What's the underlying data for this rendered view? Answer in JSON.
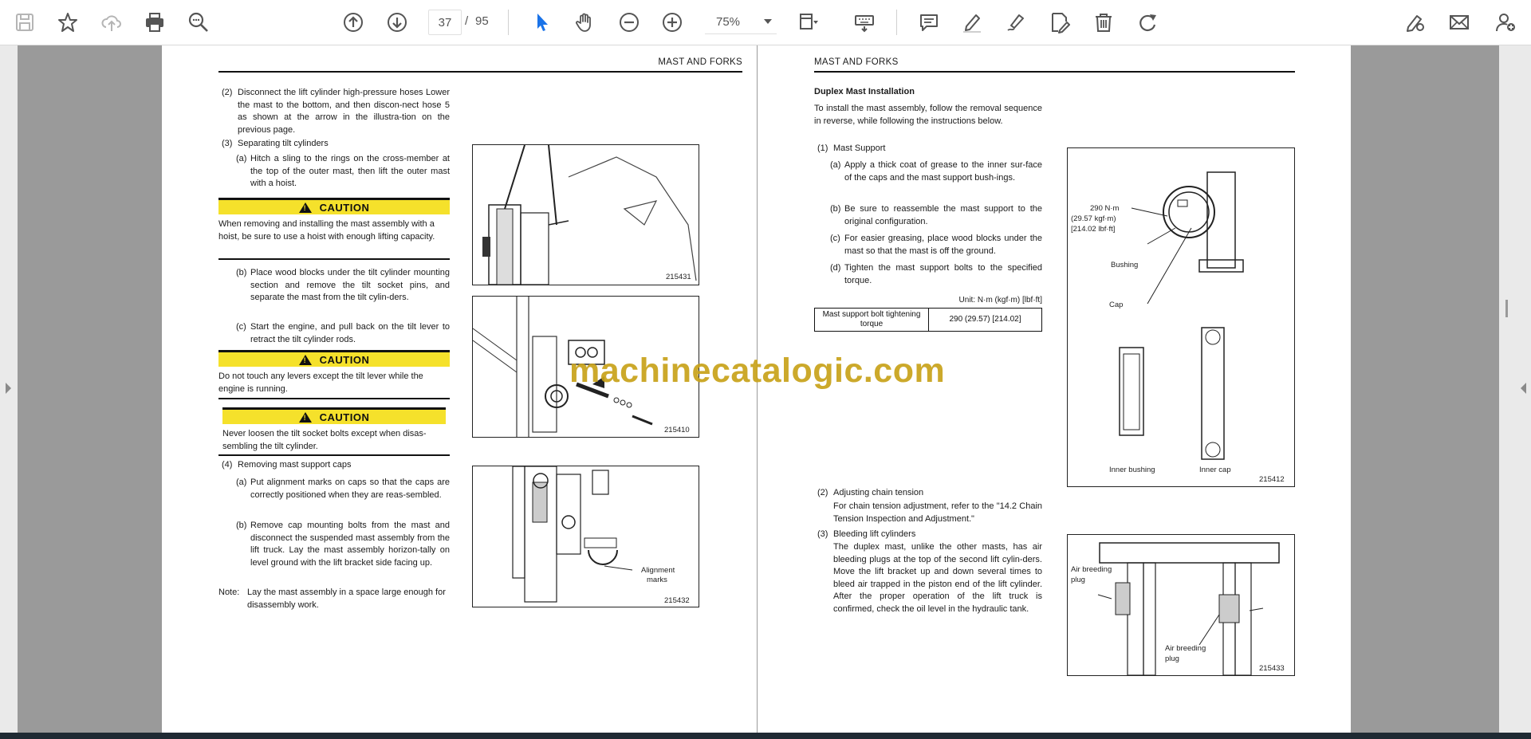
{
  "toolbar": {
    "current_page": "37",
    "page_separator": "/",
    "total_pages": "95",
    "zoom": "75%",
    "accent_color": "#1a73e8"
  },
  "left_page": {
    "header": "MAST AND FORKS",
    "step2_num": "(2)",
    "step2_text": "Disconnect the lift cylinder high-pressure hoses Lower the mast to the bottom, and then discon-nect hose 5 as shown at the arrow in the illustra-tion on the previous page.",
    "step3_num": "(3)",
    "step3_text": "Separating tilt cylinders",
    "step3a_num": "(a)",
    "step3a_text": "Hitch a sling to the rings on the cross-member at the top of the outer mast, then lift the outer mast with a hoist.",
    "caution_label": "CAUTION",
    "caution1_text": "When removing and installing the mast assembly with a hoist, be sure to use a hoist with enough lifting capacity.",
    "step3b_num": "(b)",
    "step3b_text": "Place wood blocks under the tilt cylinder mounting section and remove the tilt socket pins, and separate the mast from the tilt cylin-ders.",
    "step3c_num": "(c)",
    "step3c_text": "Start the engine, and pull back on the tilt lever to retract the tilt cylinder rods.",
    "caution2_text": "Do not touch any levers except the tilt lever while the engine is running.",
    "caution3_text": "Never loosen the tilt socket bolts except when disas-sembling the tilt cylinder.",
    "step4_num": "(4)",
    "step4_text": "Removing mast support caps",
    "step4a_num": "(a)",
    "step4a_text": "Put alignment marks on caps so that the caps are correctly positioned when they are reas-sembled.",
    "step4b_num": "(b)",
    "step4b_text": "Remove cap mounting bolts from the mast and disconnect the suspended mast assembly from the lift truck. Lay the mast assembly horizon-tally on level ground with the lift bracket side facing up.",
    "note_label": "Note:",
    "note_text": "Lay the mast assembly in a space large enough for disassembly work.",
    "fig1_num": "215431",
    "fig2_num": "215410",
    "fig3_num": "215432",
    "fig3_label_1": "Alignment",
    "fig3_label_2": "marks"
  },
  "right_page": {
    "header": "MAST AND FORKS",
    "section_title": "Duplex Mast Installation",
    "intro": "To install the mast assembly, follow the removal sequence in reverse, while following the instructions below.",
    "step1_num": "(1)",
    "step1_text": "Mast Support",
    "step1a_num": "(a)",
    "step1a_text": "Apply a thick coat of grease to the inner sur-face of the caps and the mast support bush-ings.",
    "step1b_num": "(b)",
    "step1b_text": "Be sure to reassemble the mast support to the original configuration.",
    "step1c_num": "(c)",
    "step1c_text": "For easier greasing, place wood blocks under the mast so that the mast is off the ground.",
    "step1d_num": "(d)",
    "step1d_text": "Tighten the mast support bolts to the specified torque.",
    "unit_label": "Unit: N·m (kgf·m) [lbf·ft]",
    "table_col1": "Mast support bolt tightening torque",
    "table_col2": "290 (29.57) [214.02]",
    "step2_num": "(2)",
    "step2_title": "Adjusting chain tension",
    "step2_text": "For chain tension adjustment, refer to the \"14.2 Chain Tension Inspection and Adjustment.\"",
    "step3_num": "(3)",
    "step3_title": "Bleeding lift cylinders",
    "step3_text": "The duplex mast, unlike the other masts, has air bleeding plugs at the top of the second lift cylin-ders. Move the lift bracket up and down several times to bleed air trapped in the piston end of the lift cylinder. After the proper operation of the lift truck is confirmed, check the oil level in the hydraulic tank.",
    "fig4_torque_1": "290 N·m",
    "fig4_torque_2": "(29.57 kgf·m)",
    "fig4_torque_3": "[214.02 lbf·ft]",
    "fig4_bushing": "Bushing",
    "fig4_cap": "Cap",
    "fig4_inner_bushing": "Inner bushing",
    "fig4_inner_cap": "Inner cap",
    "fig4_num": "215412",
    "fig5_plug1_1": "Air breeding",
    "fig5_plug1_2": "plug",
    "fig5_plug2_1": "Air breeding",
    "fig5_plug2_2": "plug",
    "fig5_num": "215433"
  },
  "watermark": "machinecatalogic.com"
}
